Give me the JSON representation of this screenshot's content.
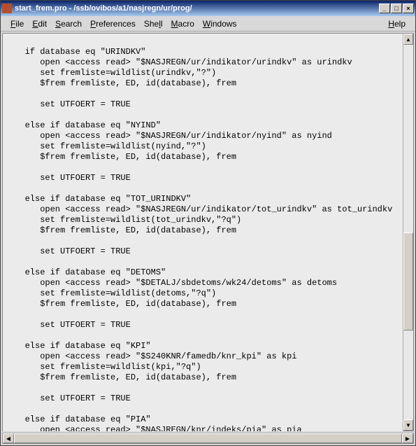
{
  "window": {
    "title": "start_frem.pro - /ssb/ovibos/a1/nasjregn/ur/prog/",
    "buttons": {
      "min": "_",
      "max": "□",
      "close": "×"
    }
  },
  "menu": {
    "file": "File",
    "edit": "Edit",
    "search": "Search",
    "preferences": "Preferences",
    "shell": "Shell",
    "macro": "Macro",
    "windows": "Windows",
    "help": "Help"
  },
  "code": "\n   if database eq \"URINDKV\"\n      open <access read> \"$NASJREGN/ur/indikator/urindkv\" as urindkv\n      set fremliste=wildlist(urindkv,\"?\")\n      $frem fremliste, ED, id(database), frem\n\n      set UTFOERT = TRUE\n\n   else if database eq \"NYIND\"\n      open <access read> \"$NASJREGN/ur/indikator/nyind\" as nyind\n      set fremliste=wildlist(nyind,\"?\")\n      $frem fremliste, ED, id(database), frem\n\n      set UTFOERT = TRUE\n\n   else if database eq \"TOT_URINDKV\"\n      open <access read> \"$NASJREGN/ur/indikator/tot_urindkv\" as tot_urindkv\n      set fremliste=wildlist(tot_urindkv,\"?q\")\n      $frem fremliste, ED, id(database), frem\n\n      set UTFOERT = TRUE\n\n   else if database eq \"DETOMS\"\n      open <access read> \"$DETALJ/sbdetoms/wk24/detoms\" as detoms\n      set fremliste=wildlist(detoms,\"?q\")\n      $frem fremliste, ED, id(database), frem\n\n      set UTFOERT = TRUE\n\n   else if database eq \"KPI\"\n      open <access read> \"$S240KNR/famedb/knr_kpi\" as kpi\n      set fremliste=wildlist(kpi,\"?q\")\n      $frem fremliste, ED, id(database), frem\n\n      set UTFOERT = TRUE\n\n   else if database eq \"PIA\"\n      open <access read> \"$NASJREGN/knr/indeks/pia\" as pia\n      set fremliste=wildlist(pia,\"?q\")\n      $frem fremliste, ED, id(database), frem\n\n      set UTFOERT = TRUE\n\n   end if                           --sjekk av databasenavn"
}
